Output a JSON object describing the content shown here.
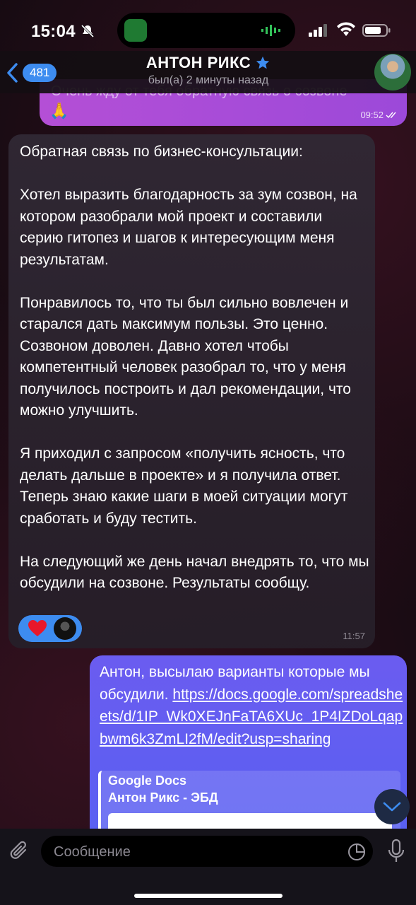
{
  "status_bar": {
    "time": "15:04"
  },
  "header": {
    "back_count": "481",
    "contact_name": "АНТОН РИКС",
    "last_seen": "был(а) 2 минуты назад"
  },
  "messages": {
    "outgoing_top": {
      "text": "Очень жду от тебя обратную связь о созвоне",
      "emoji": "🙏",
      "time": "09:52"
    },
    "incoming": {
      "text": "Обратная связь по бизнес-консультации:\n\nХотел выразить благодарность за зум созвон, на котором разобрали мой проект и составили серию гитопез и шагов к интересующим меня результатам.\n\nПонравилось то, что ты был сильно вовлечен и старался дать максимум пользы. Это ценно. Созвоном доволен. Давно хотел чтобы компетентный человек разобрал то, что у меня получилось построить и дал рекомендации, что можно улучшить.\n\nЯ приходил с запросом «получить ясность, что делать дальше в проекте» и я получила ответ. Теперь знаю какие шаги в моей ситуации могут сработать и буду тестить.\n\nНа следующий же день начал внедрять то, что мы обсудили на созвоне. Результаты сообщу.",
      "time": "11:57",
      "reaction": "heart"
    },
    "outgoing_link": {
      "text_before": "Антон, высылаю варианты которые мы обсудили. ",
      "link": "https://docs.google.com/spreadsheets/d/1IP_Wk0XEJnFaTA6XUc_1P4IZDoLqapbwm6k3ZmLI2fM/edit?usp=sharing",
      "preview_site": "Google Docs",
      "preview_title": "Антон Рикс - ЭБД"
    }
  },
  "composer": {
    "placeholder": "Сообщение"
  },
  "colors": {
    "accent": "#3d8cf0",
    "outgoing_purple": "#b44fd6",
    "outgoing_blue": "#5860f2",
    "incoming_bg": "#2e2632"
  }
}
